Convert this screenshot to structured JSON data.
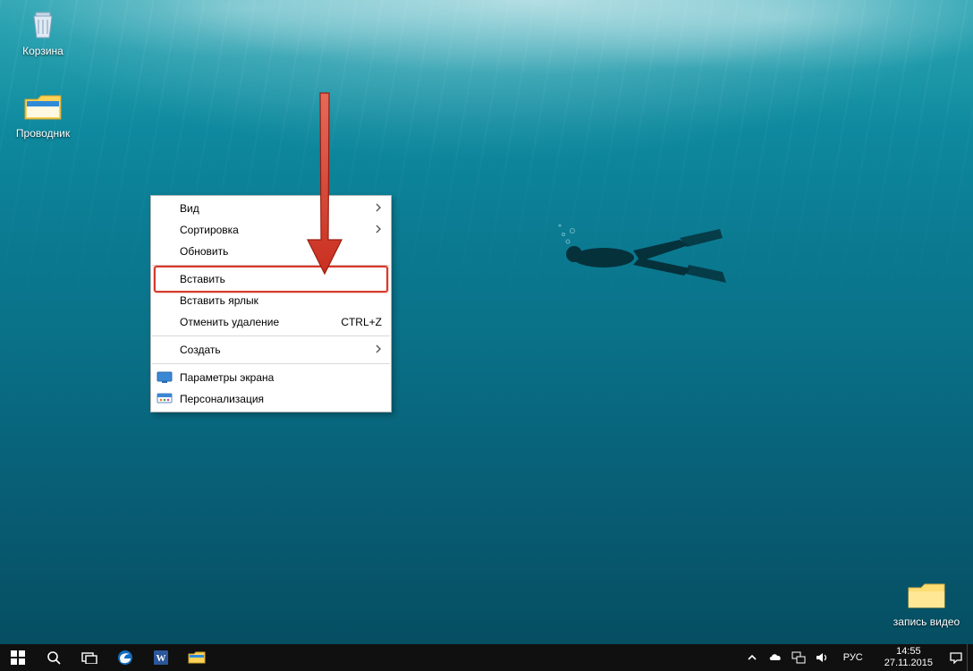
{
  "desktop_icons": {
    "recycle_bin": {
      "label": "Корзина"
    },
    "explorer": {
      "label": "Проводник"
    },
    "folder": {
      "label": "запись видео"
    }
  },
  "context_menu": {
    "view": "Вид",
    "sort": "Сортировка",
    "refresh": "Обновить",
    "paste": "Вставить",
    "paste_shortcut": "Вставить ярлык",
    "undo_delete": "Отменить удаление",
    "undo_key": "CTRL+Z",
    "create": "Создать",
    "display": "Параметры экрана",
    "personalize": "Персонализация"
  },
  "tray": {
    "lang": "РУС",
    "time": "14:55",
    "date": "27.11.2015"
  }
}
